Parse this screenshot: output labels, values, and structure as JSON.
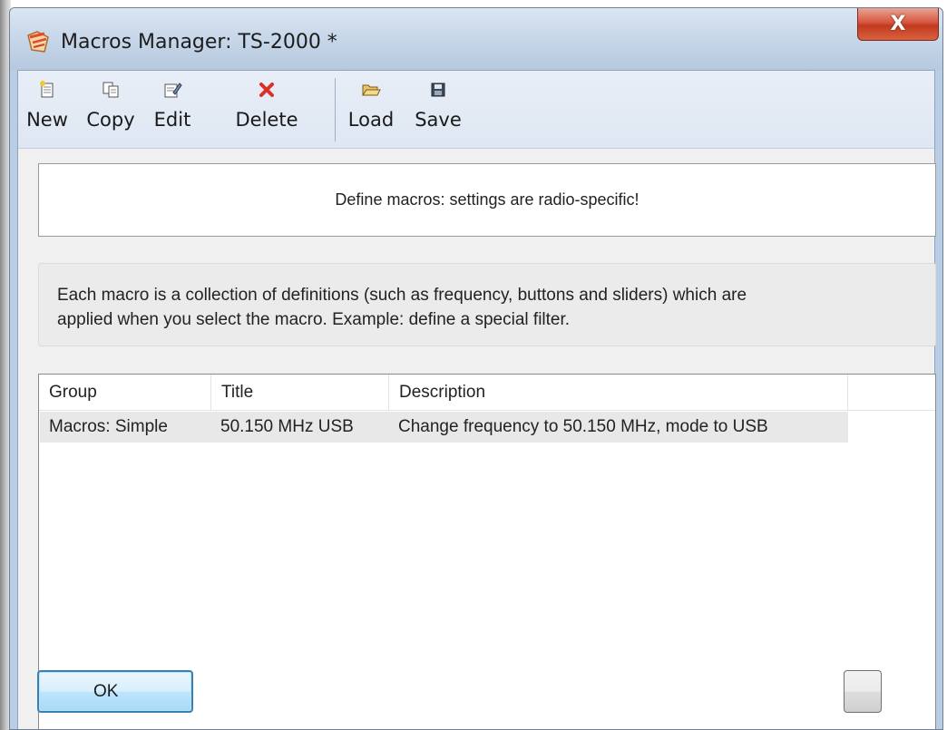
{
  "window": {
    "title": "Macros Manager: TS-2000 *",
    "close_label": "X"
  },
  "toolbar": {
    "new_label": "New",
    "copy_label": "Copy",
    "edit_label": "Edit",
    "delete_label": "Delete",
    "load_label": "Load",
    "save_label": "Save"
  },
  "banner": {
    "text": "Define macros: settings are radio-specific!"
  },
  "info": {
    "line1": "Each macro is a collection of definitions (such as frequency, buttons and sliders) which are",
    "line2": "applied when you select the macro. Example: define a special filter."
  },
  "grid": {
    "columns": [
      "Group",
      "Title",
      "Description"
    ],
    "rows": [
      [
        "Macros: Simple",
        "50.150 MHz USB",
        "Change frequency to 50.150 MHz, mode to USB"
      ]
    ]
  },
  "footer": {
    "ok_label": "OK",
    "help_label": ""
  },
  "colors": {
    "close_button": "#c9412a",
    "toolbar_bg": "#e3eaf5",
    "ok_border": "#3c7fb1"
  },
  "icons": [
    "app-icon",
    "new-icon",
    "copy-icon",
    "edit-icon",
    "delete-icon",
    "load-icon",
    "save-icon"
  ]
}
